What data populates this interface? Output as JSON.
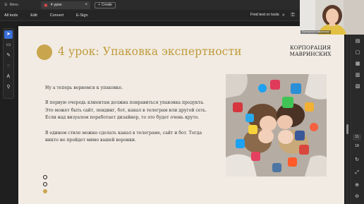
{
  "titlebar": {
    "menu_label": "Menu",
    "tab_title": "4 урок",
    "create_label": "Create"
  },
  "toolbar": {
    "menus": [
      "All tools",
      "Edit",
      "Convert",
      "E-Sign"
    ],
    "find_label": "Find text or tools"
  },
  "slide": {
    "title": "4 урок: Упаковка экспертности",
    "brand_line1": "КОРПОРАЦИЯ",
    "brand_line2": "МАВРИНСКИХ",
    "paragraphs": [
      "Ну а теперь вернемся к упаковке.",
      "В первую очередь клиентам должна понравиться упаковка продукта. Это может быть сайт, лендинг, бот, канал в телеграм или другой сеть. Если над визуалом поработает дизайнер, то это будет очень круто.",
      "В едином стиле можно сделать канал в телеграме, сайт и бот. Тогда никто не пройдет мимо вашей воронки."
    ],
    "nav_dots": [
      false,
      false,
      true
    ]
  },
  "right_rail": {
    "page_numbers": [
      "11",
      "18"
    ]
  },
  "webcam": {
    "name_label": "Екатерина Мавринская"
  },
  "colors": {
    "accent_gold": "#c9a64e",
    "title_gold": "#c09a3a",
    "slide_bg": "#f1ebe3",
    "app_dark": "#1f1f1f",
    "selection_blue": "#3a6fd8"
  },
  "icons": [
    "menu-icon",
    "pdf-icon",
    "close-icon",
    "plus-icon",
    "search-icon",
    "lock-icon",
    "print-icon",
    "share-icon",
    "cursor-icon",
    "comment-icon",
    "pen-icon",
    "lasso-icon",
    "text-icon",
    "stamp-icon",
    "hand-icon",
    "page-icon",
    "fullscreen-icon",
    "zoom-icon"
  ]
}
